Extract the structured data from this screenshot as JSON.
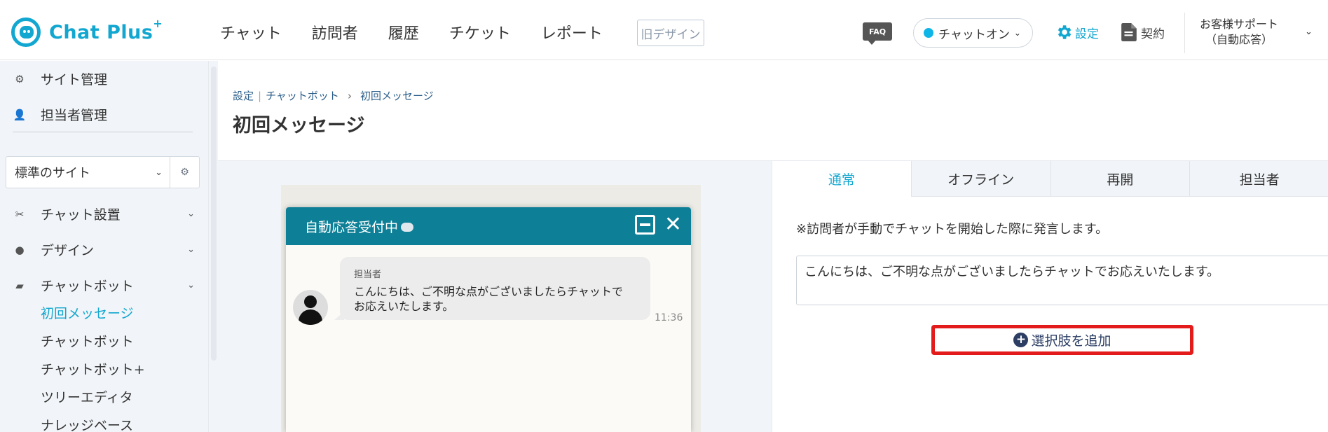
{
  "header": {
    "logo_text": "Chat Plus",
    "logo_sup": "+",
    "nav": [
      "チャット",
      "訪問者",
      "履歴",
      "チケット",
      "レポート"
    ],
    "old_design": "旧デザイン",
    "faq": "FAQ",
    "chat_status": "チャットオン",
    "settings": "設定",
    "contract": "契約",
    "support_line1": "お客様サポート",
    "support_line2": "（自動応答）",
    "accent_color": "#12a7d0"
  },
  "sidebar": {
    "site_admin": "サイト管理",
    "staff_admin": "担当者管理",
    "site_select": "標準のサイト",
    "chat_setup": "チャット設置",
    "design": "デザイン",
    "chatbot": "チャットボット",
    "sub_items": [
      "初回メッセージ",
      "チャットボット",
      "チャットボット+",
      "ツリーエディタ",
      "ナレッジベース"
    ]
  },
  "main": {
    "breadcrumb_1": "設定",
    "breadcrumb_2": "チャットボット",
    "breadcrumb_3": "初回メッセージ",
    "title": "初回メッセージ"
  },
  "preview": {
    "header_title": "自動応答受付中",
    "sender": "担当者",
    "message_line1": "こんにちは、ご不明な点がございましたらチャットで",
    "message_line2": "お応えいたします。",
    "time": "11:36"
  },
  "panel": {
    "tabs": [
      "通常",
      "オフライン",
      "再開",
      "担当者"
    ],
    "note": "※訪問者が手動でチャットを開始した際に発言します。",
    "message_value": "こんにちは、ご不明な点がございましたらチャットでお応えいたします。",
    "add_choice": "選択肢を追加",
    "highlight_color": "#e31b1b"
  }
}
